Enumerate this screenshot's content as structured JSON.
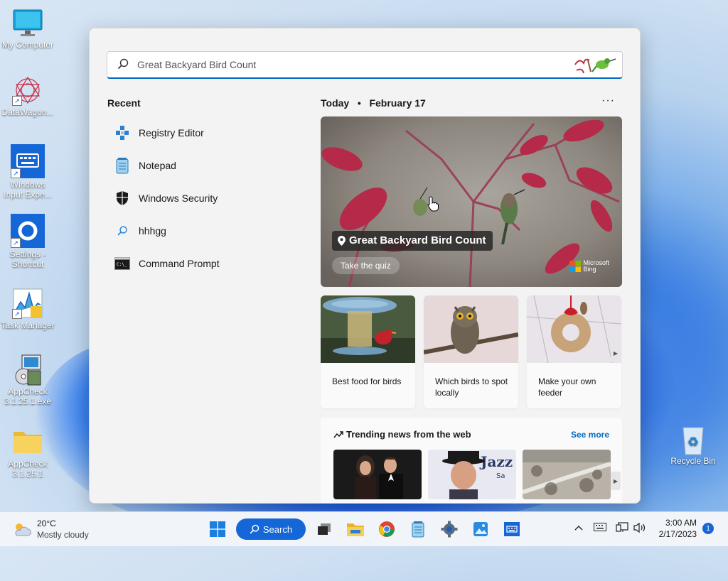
{
  "desktop": {
    "icons": [
      {
        "label": "My Computer"
      },
      {
        "label": "DataWagon..."
      },
      {
        "label": "Windows Input Expe..."
      },
      {
        "label": "Settings - Shortcut"
      },
      {
        "label": "Task Manager"
      },
      {
        "label": "AppCheck 3.1.25.1.exe"
      },
      {
        "label": "AppCheck 3.1.25.1"
      },
      {
        "label": "Recycle Bin"
      }
    ]
  },
  "search": {
    "query": "Great Backyard Bird Count",
    "recent_title": "Recent",
    "recent": [
      {
        "label": "Registry Editor",
        "icon": "registry-editor-icon"
      },
      {
        "label": "Notepad",
        "icon": "notepad-icon"
      },
      {
        "label": "Windows Security",
        "icon": "shield-icon"
      },
      {
        "label": "hhhgg",
        "icon": "search-icon"
      },
      {
        "label": "Command Prompt",
        "icon": "command-prompt-icon"
      }
    ],
    "today_label": "Today",
    "date": "February 17",
    "more": "···",
    "hero": {
      "title": "Great Backyard Bird Count",
      "cta": "Take the quiz",
      "brand_line1": "Microsoft",
      "brand_line2": "Bing"
    },
    "cards": [
      {
        "caption": "Best food for birds"
      },
      {
        "caption": "Which birds to spot locally"
      },
      {
        "caption": "Make your own feeder"
      }
    ],
    "trending": {
      "title": "Trending news from the web",
      "see_more": "See more"
    }
  },
  "taskbar": {
    "weather_temp": "20°C",
    "weather_desc": "Mostly cloudy",
    "search_label": "Search",
    "time": "3:00 AM",
    "date": "2/17/2023",
    "notifications": "1"
  },
  "colors": {
    "accent": "#0067c0",
    "taskbar_search": "#1566d6"
  }
}
